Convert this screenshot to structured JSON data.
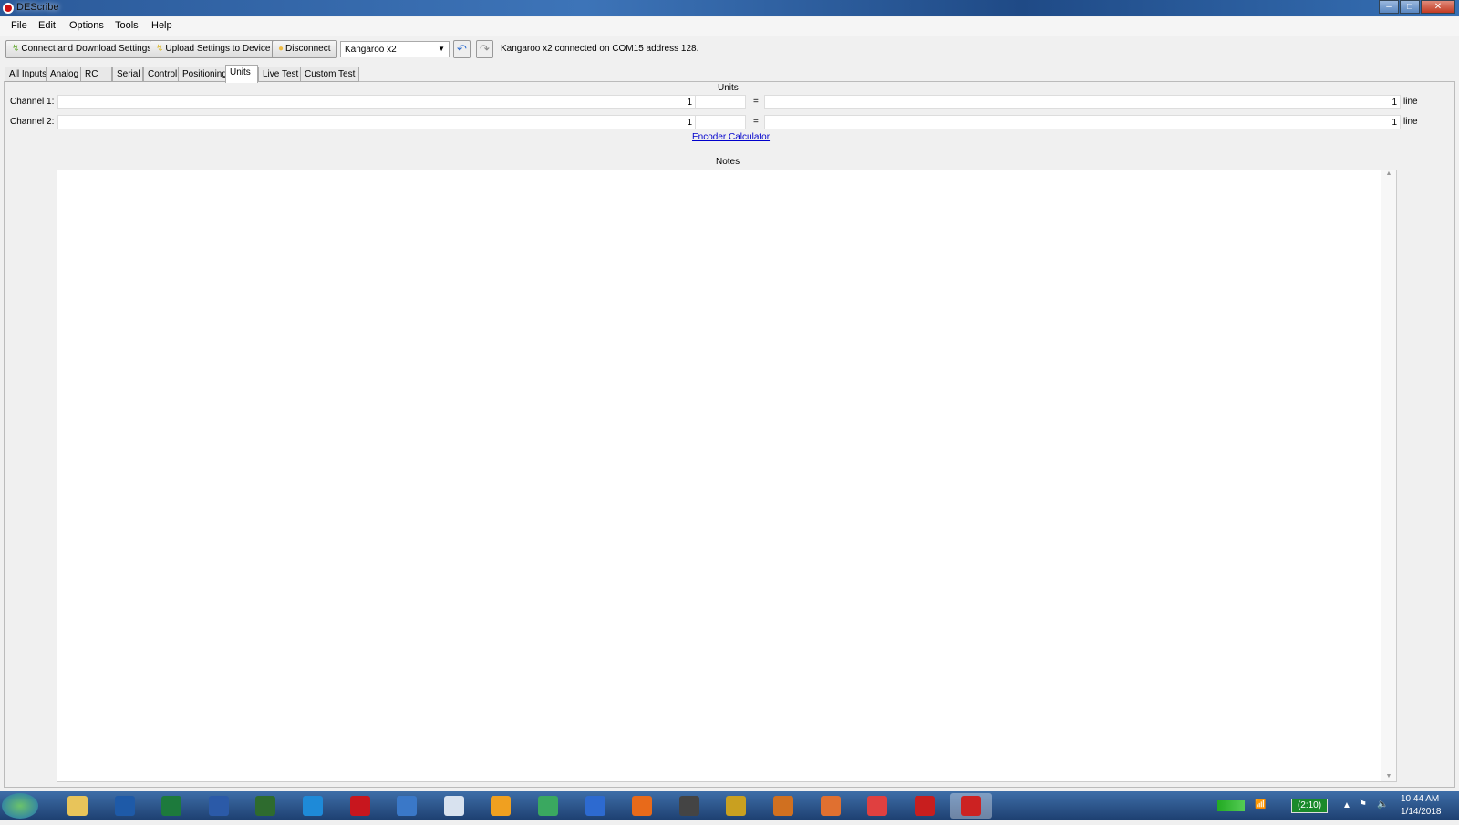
{
  "window": {
    "title": "DEScribe"
  },
  "menu": [
    "File",
    "Edit",
    "Options",
    "Tools",
    "Help"
  ],
  "toolbar": {
    "connect": "Connect and Download Settings",
    "upload": "Upload Settings to Device",
    "disconnect": "Disconnect",
    "device": "Kangaroo x2",
    "status": "Kangaroo x2 connected on COM15 address 128."
  },
  "tabs": [
    "All Inputs",
    "Analog",
    "RC",
    "Serial",
    "Control",
    "Positioning",
    "Units",
    "Live Test",
    "Custom Test"
  ],
  "active_tab": "Units",
  "units": {
    "header": "Units",
    "rows": [
      {
        "label": "Channel 1:",
        "left_value": "1",
        "unit_name": "",
        "equals": "=",
        "right_value": "1",
        "right_unit": "line"
      },
      {
        "label": "Channel 2:",
        "left_value": "1",
        "unit_name": "",
        "equals": "=",
        "right_value": "1",
        "right_unit": "line"
      }
    ],
    "encoder_link": "Encoder Calculator",
    "notes_label": "Notes",
    "notes": ""
  },
  "taskbar": {
    "apps": [
      "Start",
      "Windows Explorer",
      "Outlook",
      "Excel",
      "Word",
      "Project",
      "TeamViewer",
      "Acrobat",
      "Settings",
      "Calculator",
      "F App",
      "Chart App",
      "A App",
      "Firefox",
      "Keyboard App",
      "App",
      "App",
      "App",
      "App",
      "App",
      "DEScribe"
    ],
    "battery": "(2:10)",
    "time": "10:44 AM",
    "date": "1/14/2018"
  }
}
